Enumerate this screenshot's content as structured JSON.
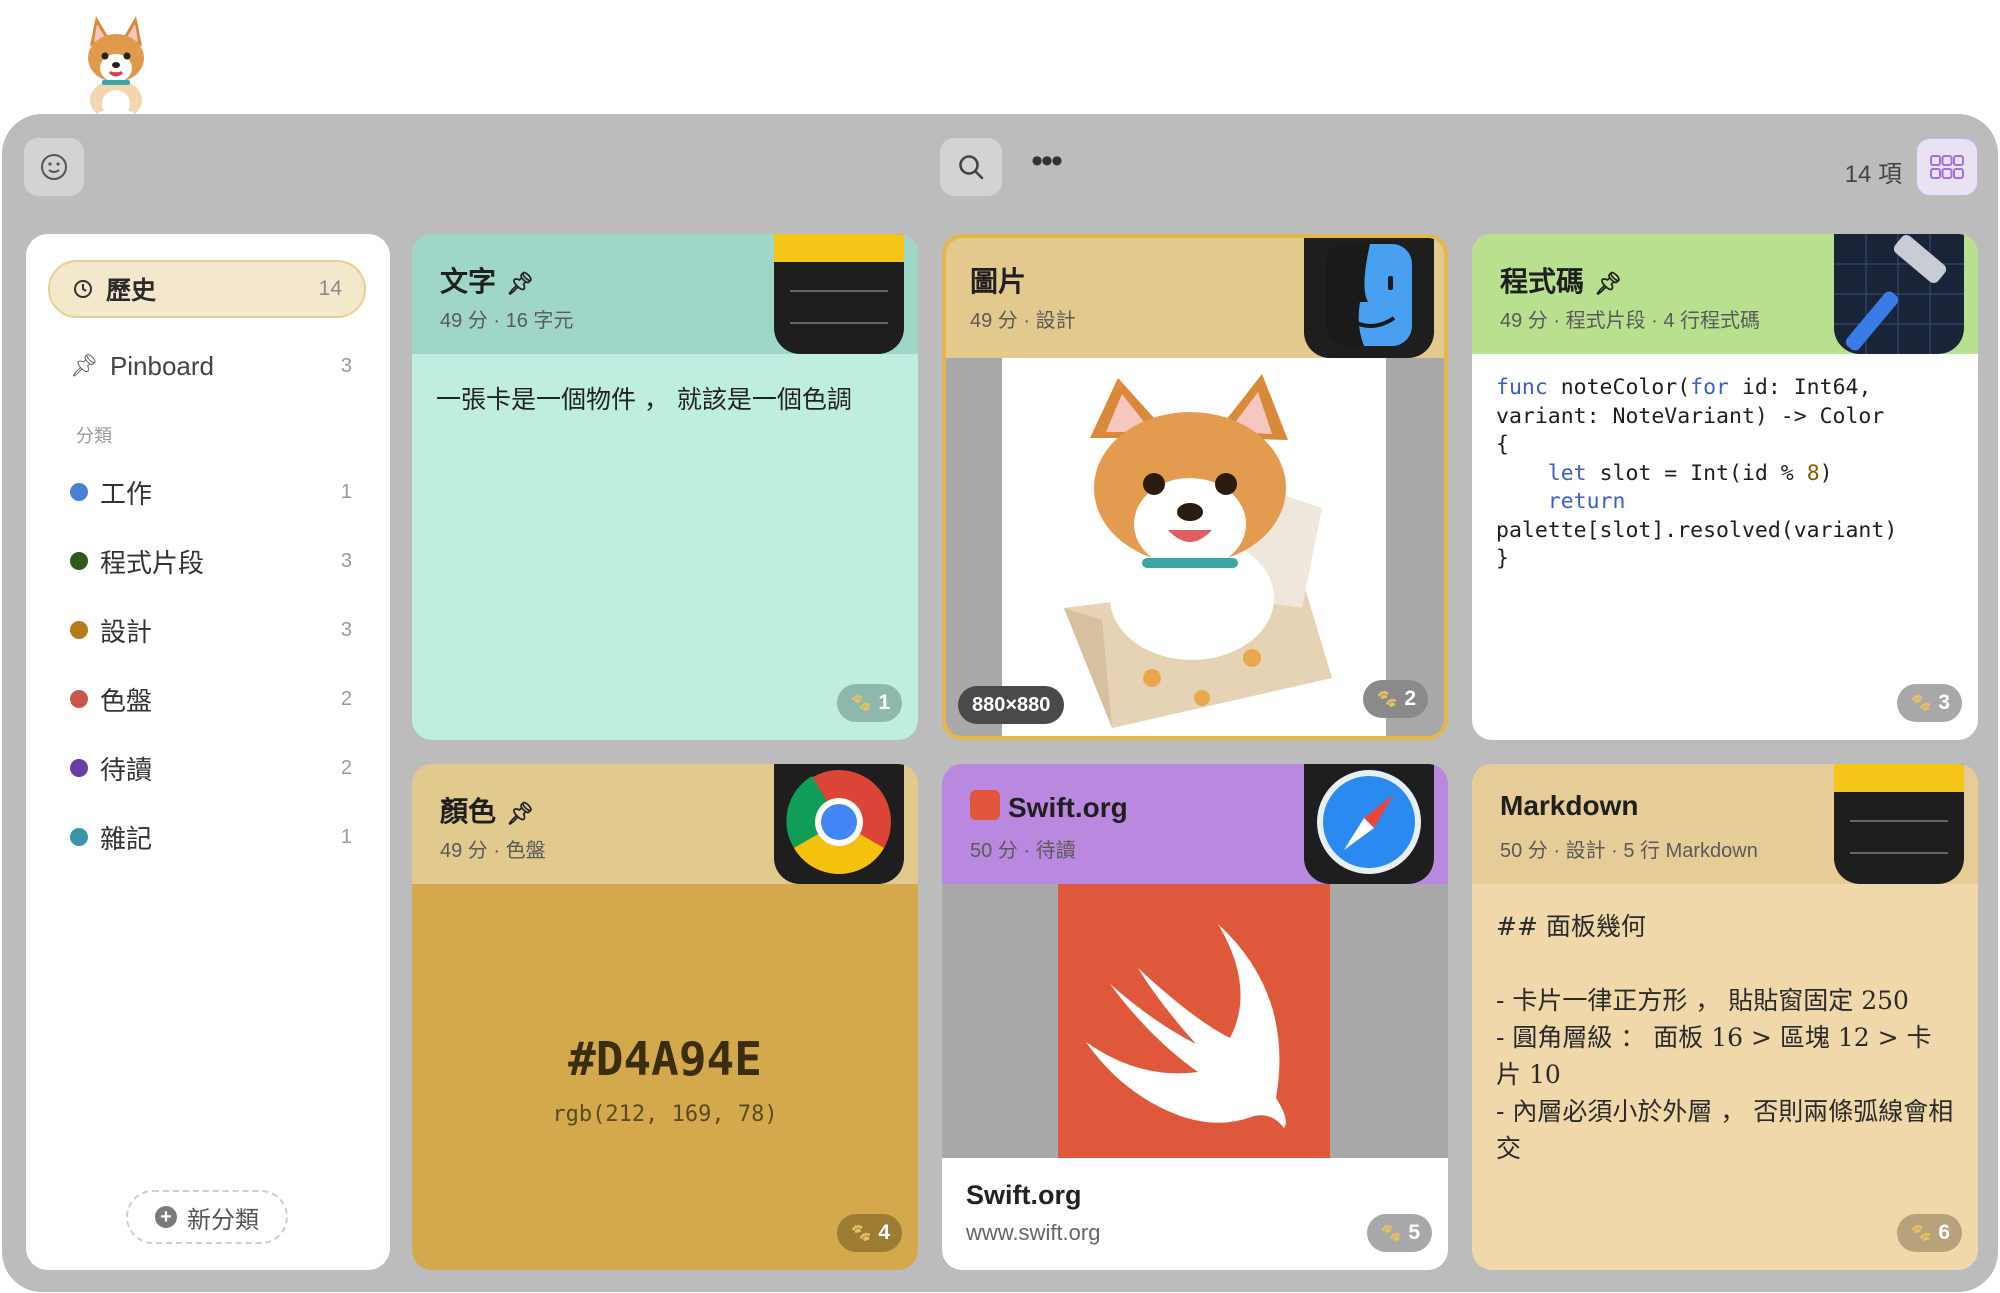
{
  "toolbar": {
    "item_count": "14 項"
  },
  "sidebar": {
    "history": {
      "label": "歷史",
      "count": "14"
    },
    "pinboard": {
      "label": "Pinboard",
      "count": "3"
    },
    "section_label": "分類",
    "categories": [
      {
        "label": "工作",
        "count": "1",
        "color": "#4a7fd4"
      },
      {
        "label": "程式片段",
        "count": "3",
        "color": "#2f5a1e"
      },
      {
        "label": "設計",
        "count": "3",
        "color": "#b57a1a"
      },
      {
        "label": "色盤",
        "count": "2",
        "color": "#c9574f"
      },
      {
        "label": "待讀",
        "count": "2",
        "color": "#6a3ea6"
      },
      {
        "label": "雜記",
        "count": "1",
        "color": "#3a95a6"
      }
    ],
    "new_category": "新分類"
  },
  "cards": [
    {
      "title": "文字",
      "subtitle": "49 分 · 16 字元",
      "body": "一張卡是一個物件 ， 就該是一個色調",
      "badge": "1",
      "header_color": "#9fd6c8",
      "body_color": "#bfeee0",
      "app": "notes-icon"
    },
    {
      "title": "圖片",
      "subtitle": "49 分 · 設計",
      "dimensions": "880×880",
      "badge": "2",
      "header_color": "#e4c98e",
      "app": "finder-icon"
    },
    {
      "title": "程式碼",
      "subtitle": "49 分 · 程式片段 · 4 行程式碼",
      "badge": "3",
      "header_color": "#b8e08e",
      "body_color": "#ffffff",
      "app": "xcode-icon",
      "code": [
        "func noteColor(for id: Int64,",
        "variant: NoteVariant) -> Color",
        "{",
        "    let slot = Int(id % 8)",
        "    return",
        "palette[slot].resolved(variant)",
        "}"
      ]
    },
    {
      "title": "顏色",
      "subtitle": "49 分 · 色盤",
      "hex": "#D4A94E",
      "rgb": "rgb(212, 169, 78)",
      "badge": "4",
      "header_color": "#e2c98e",
      "body_color": "#d4a94e",
      "app": "chrome-icon"
    },
    {
      "title": "Swift.org",
      "subtitle": "50 分 · 待讀",
      "link_title": "Swift.org",
      "link_url": "www.swift.org",
      "badge": "5",
      "header_color": "#bb88e0",
      "app": "safari-icon"
    },
    {
      "title": "Markdown",
      "subtitle": "50 分 · 設計 · 5 行 Markdown",
      "badge": "6",
      "header_color": "#e6cc96",
      "body_color": "#f0d8aa",
      "app": "notes-icon",
      "md_heading": "## 面板幾何",
      "md_lines": [
        "- 卡片一律正方形 ， 貼貼窗固定 250",
        "- 圓角層級 ： 面板 16 > 區塊 12 > 卡片 10",
        "- 內層必須小於外層 ， 否則兩條弧線會相交"
      ]
    }
  ]
}
